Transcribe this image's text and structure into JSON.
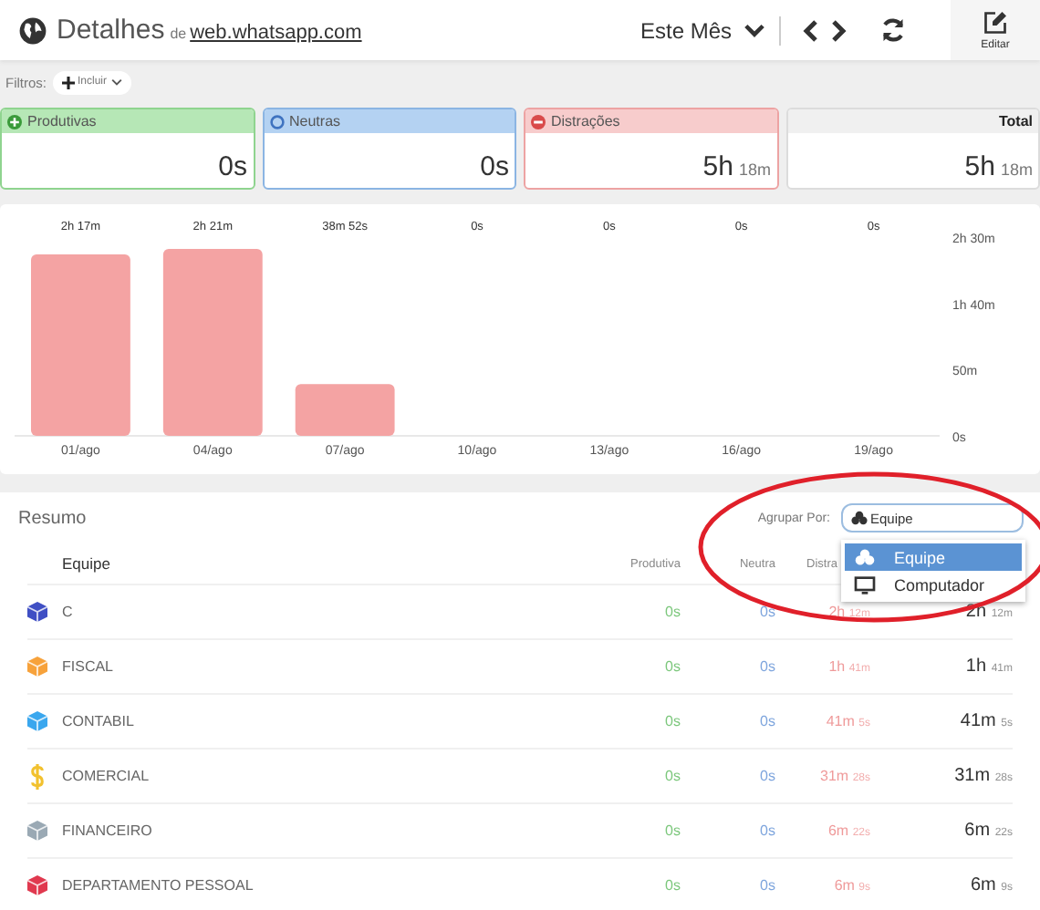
{
  "header": {
    "title": "Detalhes",
    "prefix": "de",
    "site": "web.whatsapp.com",
    "period": "Este Mês",
    "edit_label": "Editar"
  },
  "filters": {
    "label": "Filtros:",
    "add_button": "Incluir"
  },
  "cards": [
    {
      "kind": "productive",
      "label": "Produtivas",
      "value": "0s"
    },
    {
      "kind": "neutral",
      "label": "Neutras",
      "value": "0s"
    },
    {
      "kind": "distraction",
      "label": "Distrações",
      "value": "5h",
      "unit": "18m"
    },
    {
      "kind": "total",
      "label": "Total",
      "value": "5h",
      "unit": "18m"
    }
  ],
  "chart": {
    "chart_data": {
      "type": "bar",
      "categories": [
        "01/ago",
        "04/ago",
        "07/ago",
        "10/ago",
        "13/ago",
        "16/ago",
        "19/ago"
      ],
      "series": [
        {
          "color": "#f4a3a3",
          "values": [
            137,
            141,
            39,
            0,
            0,
            0,
            0
          ]
        }
      ],
      "ylim": [
        0,
        150
      ],
      "yticks": [
        {
          "value": 0,
          "label": "0s"
        },
        {
          "value": 50,
          "label": "50m"
        },
        {
          "value": 100,
          "label": "1h 40m"
        },
        {
          "value": 150,
          "label": "2h 30m"
        }
      ],
      "value_labels": [
        "2h  17m",
        "2h  21m",
        "38m  52s",
        "0s",
        "0s",
        "0s",
        "0s"
      ]
    }
  },
  "summary": {
    "title": "Resumo",
    "group_label": "Agrupar Por:",
    "group_value": "Equipe",
    "group_options": [
      {
        "label": "Equipe",
        "kind": "team",
        "selected": true
      },
      {
        "label": "Computador",
        "kind": "computer",
        "selected": false
      }
    ],
    "columns": [
      "Equipe",
      "Produtiva",
      "Neutra",
      "Distra"
    ],
    "rows": [
      {
        "kind": "cube",
        "color": "#3f4fc4",
        "name": "C",
        "productive": "0s",
        "neutral": "0s",
        "distraction": "2h",
        "distraction_sub": "12m",
        "total": "2h",
        "total_sub": "12m"
      },
      {
        "kind": "cube",
        "color": "#f7a23b",
        "name": "FISCAL",
        "productive": "0s",
        "neutral": "0s",
        "distraction": "1h",
        "distraction_sub": "41m",
        "total": "1h",
        "total_sub": "41m"
      },
      {
        "kind": "cube",
        "color": "#3aa7ee",
        "name": "CONTABIL",
        "productive": "0s",
        "neutral": "0s",
        "distraction": "41m",
        "distraction_sub": "5s",
        "total": "41m",
        "total_sub": "5s"
      },
      {
        "kind": "money",
        "color": "#f2c12e",
        "name": "COMERCIAL",
        "productive": "0s",
        "neutral": "0s",
        "distraction": "31m",
        "distraction_sub": "28s",
        "total": "31m",
        "total_sub": "28s"
      },
      {
        "kind": "cube",
        "color": "#9aa9b4",
        "name": "FINANCEIRO",
        "productive": "0s",
        "neutral": "0s",
        "distraction": "6m",
        "distraction_sub": "22s",
        "total": "6m",
        "total_sub": "22s"
      },
      {
        "kind": "cube",
        "color": "#e0394f",
        "name": "DEPARTAMENTO PESSOAL",
        "productive": "0s",
        "neutral": "0s",
        "distraction": "6m",
        "distraction_sub": "9s",
        "total": "6m",
        "total_sub": "9s"
      }
    ]
  }
}
